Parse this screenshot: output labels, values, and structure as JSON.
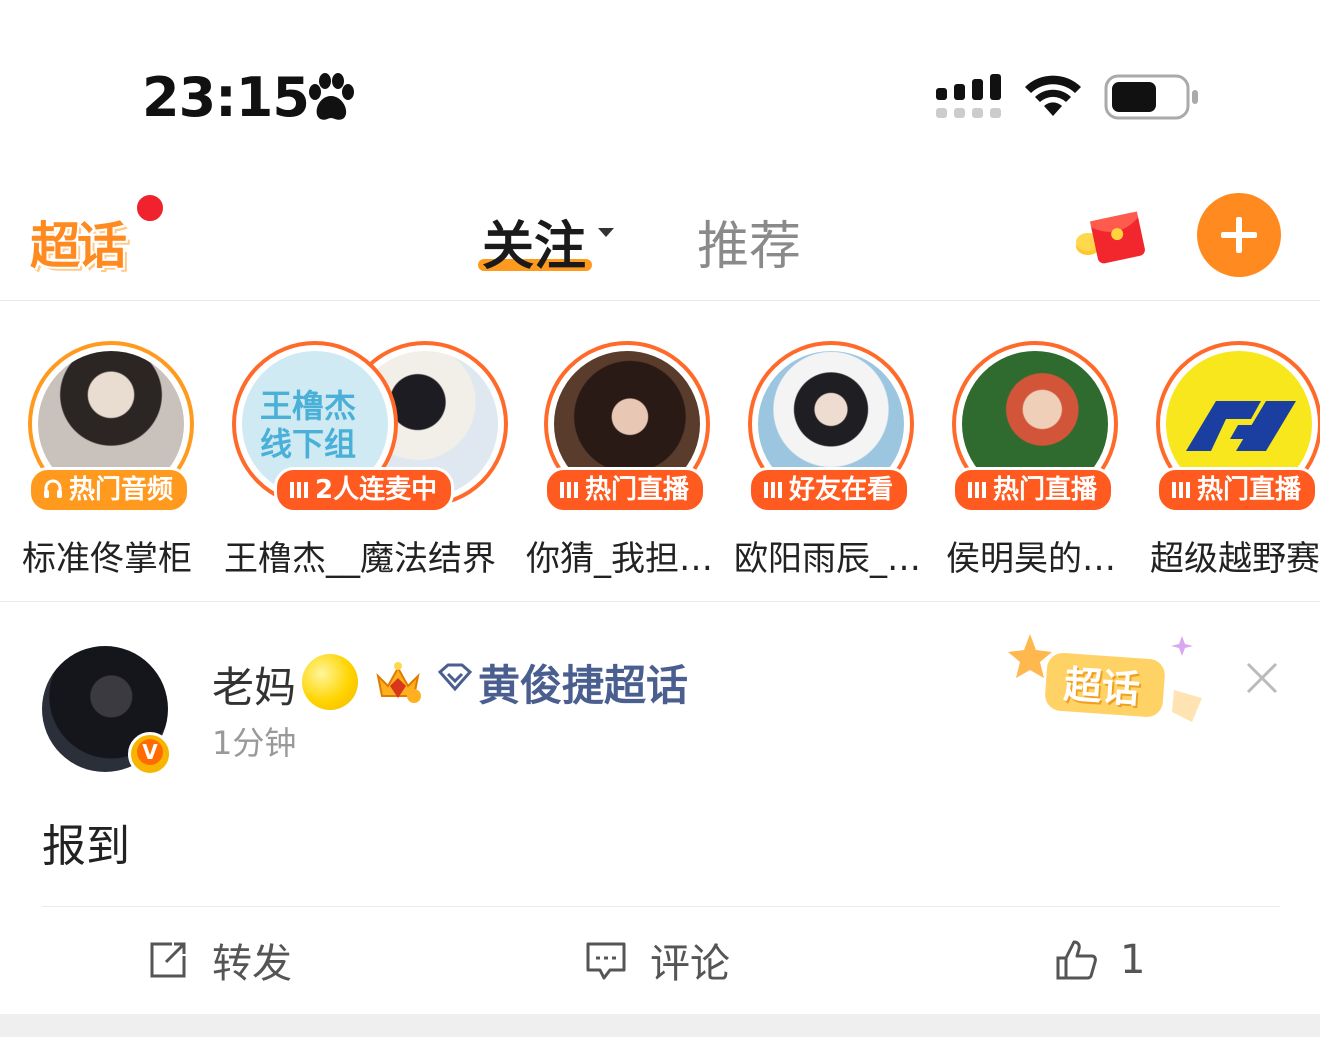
{
  "status_bar": {
    "time": "23:15",
    "icons": [
      "paw-icon",
      "signal-icon",
      "wifi-icon",
      "battery-icon"
    ]
  },
  "top_nav": {
    "logo_text": "超话",
    "tabs": [
      {
        "label": "关注",
        "active": true
      },
      {
        "label": "推荐",
        "active": false
      }
    ],
    "icons": [
      "red-packet-icon",
      "plus-icon"
    ],
    "accent_color": "#ff8a1f",
    "notification_dot_color": "#f0222d"
  },
  "stories": [
    {
      "badge": "热门音频",
      "badge_type": "audio",
      "name": "标准佟掌柜"
    },
    {
      "badge": "2人连麦中",
      "badge_type": "live",
      "name": "王橹杰__魔法结界",
      "cover_text": "王橹杰\n线下组"
    },
    {
      "badge": "热门直播",
      "badge_type": "live",
      "name": "你猜_我担…"
    },
    {
      "badge": "好友在看",
      "badge_type": "live",
      "name": "欧阳雨辰_…"
    },
    {
      "badge": "热门直播",
      "badge_type": "live",
      "name": "侯明昊的…"
    },
    {
      "badge": "热门直播",
      "badge_type": "live",
      "name": "超级越野赛"
    }
  ],
  "post": {
    "username": "老妈",
    "topic": "黄俊捷超话",
    "time": "1分钟",
    "verified_badge": "V",
    "sticker_text": "超话",
    "content": "报到",
    "actions": {
      "repost_label": "转发",
      "comment_label": "评论",
      "like_count": "1"
    }
  }
}
